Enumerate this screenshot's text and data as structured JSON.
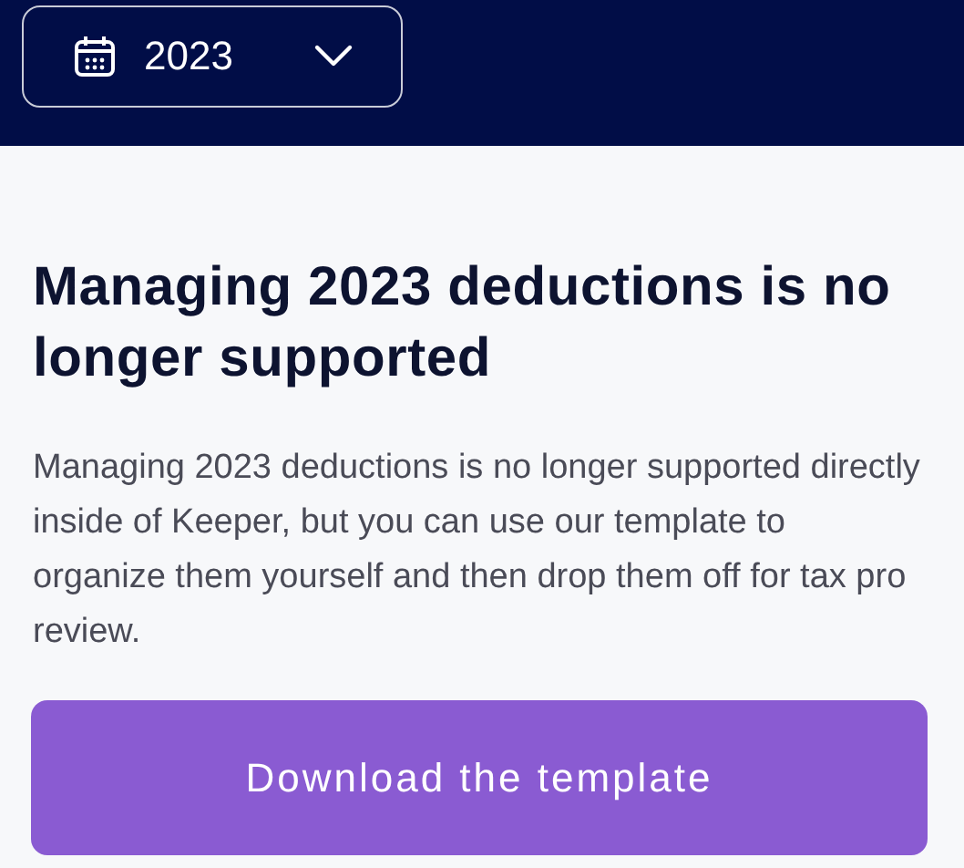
{
  "year_selector": {
    "value": "2023"
  },
  "heading": "Managing 2023 deductions is no longer supported",
  "message": "Managing 2023 deductions is no longer supported directly inside of Keeper, but you can use our template to organize them yourself and then drop them off for tax pro review.",
  "button": "Download the template"
}
